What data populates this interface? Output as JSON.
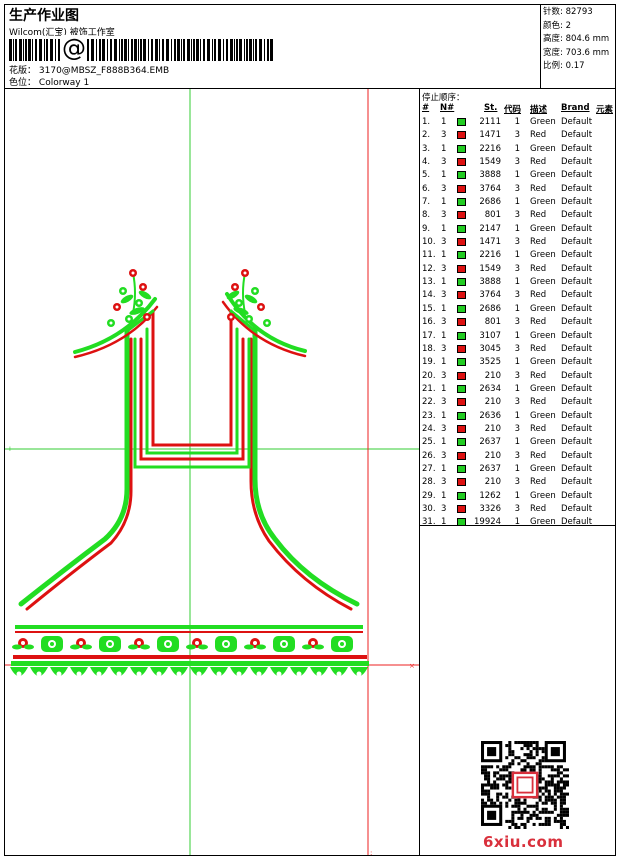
{
  "header": {
    "title": "生产作业图",
    "company": "Wilcom(汇宝) 被饰工作室",
    "barcode_char": "@",
    "pattern_label": "花版",
    "pattern_value": "3170@MBSZ_F888B364.EMB",
    "colorway_label": "色位",
    "colorway_value": "Colorway 1"
  },
  "stats": {
    "stitch_label": "针数",
    "stitch_value": "82793",
    "colors_label": "颜色",
    "colors_value": "2",
    "height_label": "高度",
    "height_value": "804.6 mm",
    "width_label": "宽度",
    "width_value": "703.6 mm",
    "scale_label": "比例",
    "scale_value": "0.17"
  },
  "stop_sequence": {
    "title": "停止顺序：",
    "columns": [
      "#",
      "N#",
      "St.",
      "代码",
      "描述",
      "Brand",
      "元素"
    ],
    "rows": [
      {
        "n": "1.",
        "c": "1",
        "st": "2111",
        "code": "1",
        "desc": "Green",
        "brand": "Default",
        "color": "#22cc22"
      },
      {
        "n": "2.",
        "c": "3",
        "st": "1471",
        "code": "3",
        "desc": "Red",
        "brand": "Default",
        "color": "#dd1111"
      },
      {
        "n": "3.",
        "c": "1",
        "st": "2216",
        "code": "1",
        "desc": "Green",
        "brand": "Default",
        "color": "#22cc22"
      },
      {
        "n": "4.",
        "c": "3",
        "st": "1549",
        "code": "3",
        "desc": "Red",
        "brand": "Default",
        "color": "#dd1111"
      },
      {
        "n": "5.",
        "c": "1",
        "st": "3888",
        "code": "1",
        "desc": "Green",
        "brand": "Default",
        "color": "#22cc22"
      },
      {
        "n": "6.",
        "c": "3",
        "st": "3764",
        "code": "3",
        "desc": "Red",
        "brand": "Default",
        "color": "#dd1111"
      },
      {
        "n": "7.",
        "c": "1",
        "st": "2686",
        "code": "1",
        "desc": "Green",
        "brand": "Default",
        "color": "#22cc22"
      },
      {
        "n": "8.",
        "c": "3",
        "st": "801",
        "code": "3",
        "desc": "Red",
        "brand": "Default",
        "color": "#dd1111"
      },
      {
        "n": "9.",
        "c": "1",
        "st": "2147",
        "code": "1",
        "desc": "Green",
        "brand": "Default",
        "color": "#22cc22"
      },
      {
        "n": "10.",
        "c": "3",
        "st": "1471",
        "code": "3",
        "desc": "Red",
        "brand": "Default",
        "color": "#dd1111"
      },
      {
        "n": "11.",
        "c": "1",
        "st": "2216",
        "code": "1",
        "desc": "Green",
        "brand": "Default",
        "color": "#22cc22"
      },
      {
        "n": "12.",
        "c": "3",
        "st": "1549",
        "code": "3",
        "desc": "Red",
        "brand": "Default",
        "color": "#dd1111"
      },
      {
        "n": "13.",
        "c": "1",
        "st": "3888",
        "code": "1",
        "desc": "Green",
        "brand": "Default",
        "color": "#22cc22"
      },
      {
        "n": "14.",
        "c": "3",
        "st": "3764",
        "code": "3",
        "desc": "Red",
        "brand": "Default",
        "color": "#dd1111"
      },
      {
        "n": "15.",
        "c": "1",
        "st": "2686",
        "code": "1",
        "desc": "Green",
        "brand": "Default",
        "color": "#22cc22"
      },
      {
        "n": "16.",
        "c": "3",
        "st": "801",
        "code": "3",
        "desc": "Red",
        "brand": "Default",
        "color": "#dd1111"
      },
      {
        "n": "17.",
        "c": "1",
        "st": "3107",
        "code": "1",
        "desc": "Green",
        "brand": "Default",
        "color": "#22cc22"
      },
      {
        "n": "18.",
        "c": "3",
        "st": "3045",
        "code": "3",
        "desc": "Red",
        "brand": "Default",
        "color": "#dd1111"
      },
      {
        "n": "19.",
        "c": "1",
        "st": "3525",
        "code": "1",
        "desc": "Green",
        "brand": "Default",
        "color": "#22cc22"
      },
      {
        "n": "20.",
        "c": "3",
        "st": "210",
        "code": "3",
        "desc": "Red",
        "brand": "Default",
        "color": "#dd1111"
      },
      {
        "n": "21.",
        "c": "1",
        "st": "2634",
        "code": "1",
        "desc": "Green",
        "brand": "Default",
        "color": "#22cc22"
      },
      {
        "n": "22.",
        "c": "3",
        "st": "210",
        "code": "3",
        "desc": "Red",
        "brand": "Default",
        "color": "#dd1111"
      },
      {
        "n": "23.",
        "c": "1",
        "st": "2636",
        "code": "1",
        "desc": "Green",
        "brand": "Default",
        "color": "#22cc22"
      },
      {
        "n": "24.",
        "c": "3",
        "st": "210",
        "code": "3",
        "desc": "Red",
        "brand": "Default",
        "color": "#dd1111"
      },
      {
        "n": "25.",
        "c": "1",
        "st": "2637",
        "code": "1",
        "desc": "Green",
        "brand": "Default",
        "color": "#22cc22"
      },
      {
        "n": "26.",
        "c": "3",
        "st": "210",
        "code": "3",
        "desc": "Red",
        "brand": "Default",
        "color": "#dd1111"
      },
      {
        "n": "27.",
        "c": "1",
        "st": "2637",
        "code": "1",
        "desc": "Green",
        "brand": "Default",
        "color": "#22cc22"
      },
      {
        "n": "28.",
        "c": "3",
        "st": "210",
        "code": "3",
        "desc": "Red",
        "brand": "Default",
        "color": "#dd1111"
      },
      {
        "n": "29.",
        "c": "1",
        "st": "1262",
        "code": "1",
        "desc": "Green",
        "brand": "Default",
        "color": "#22cc22"
      },
      {
        "n": "30.",
        "c": "3",
        "st": "3326",
        "code": "3",
        "desc": "Red",
        "brand": "Default",
        "color": "#dd1111"
      },
      {
        "n": "31.",
        "c": "1",
        "st": "19924",
        "code": "1",
        "desc": "Green",
        "brand": "Default",
        "color": "#22cc22"
      }
    ]
  },
  "design": {
    "green": "#22dd22",
    "red": "#dd1111",
    "guide_green": "#33cc33",
    "guide_red": "#ee2222"
  },
  "watermark": "6xiu.com"
}
